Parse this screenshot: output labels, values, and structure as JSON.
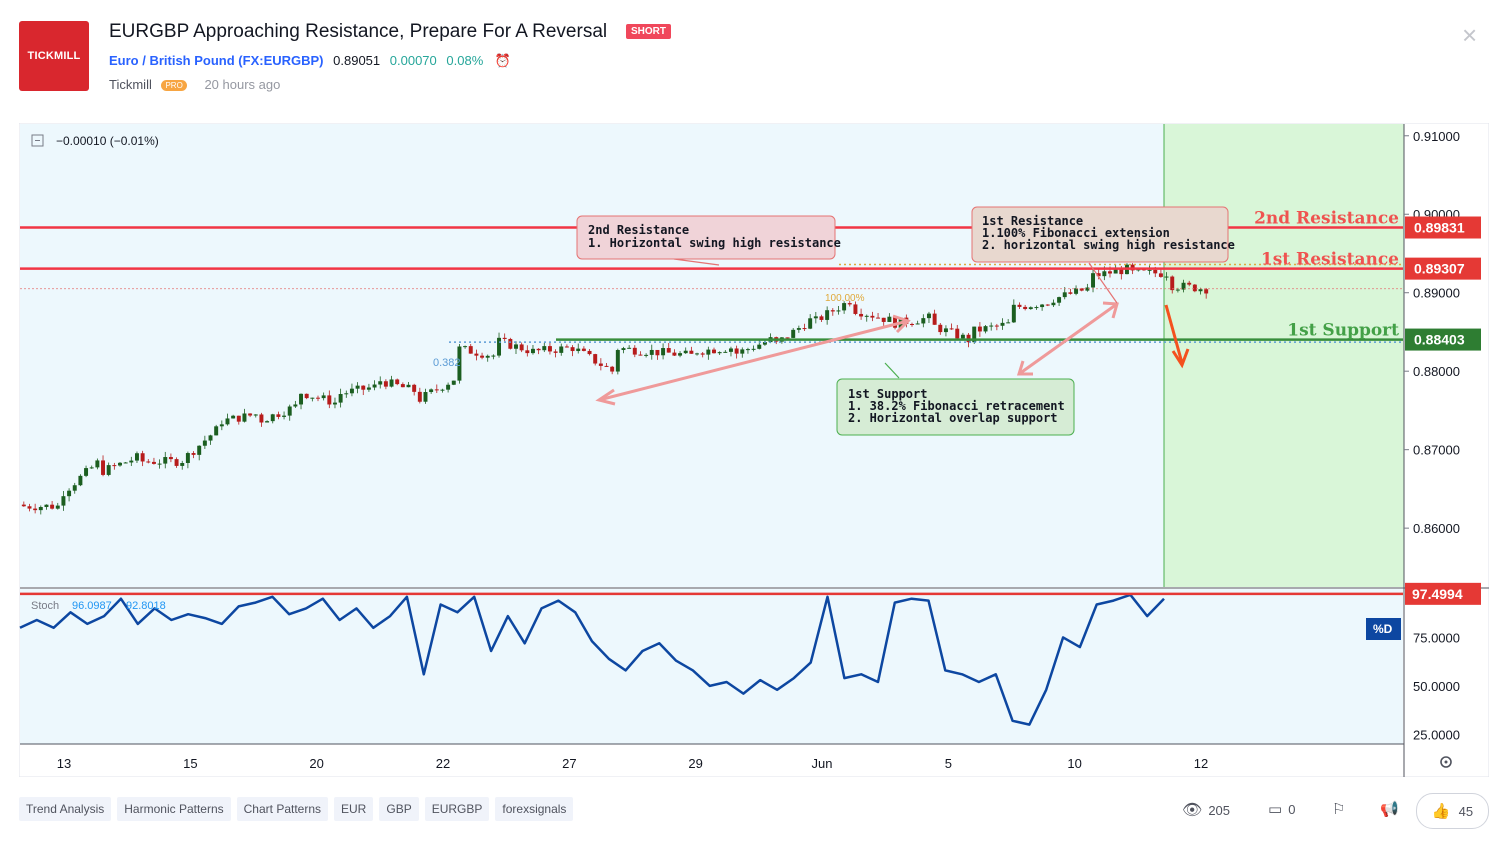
{
  "header": {
    "logo_text": "TICKMILL",
    "title": "EURGBP Approaching Resistance, Prepare For A Reversal",
    "badge": "SHORT",
    "symbol_name": "Euro / British Pound",
    "symbol_ticker": "(FX:EURGBP)",
    "price": "0.89051",
    "change": "0.00070",
    "change_pct": "0.08%",
    "author": "Tickmill",
    "author_badge": "PRO",
    "published": "20 hours ago"
  },
  "chart_data": {
    "type": "candlestick",
    "symbol": "FX:EURGBP",
    "legend_value": "−0.00010 (−0.01%)",
    "x_ticks": [
      "13",
      "15",
      "20",
      "22",
      "27",
      "29",
      "Jun",
      "5",
      "10",
      "12"
    ],
    "y_ticks": [
      "0.91000",
      "0.90000",
      "0.89000",
      "0.88000",
      "0.87000",
      "0.86000"
    ],
    "ylim": [
      0.8525,
      0.9115
    ],
    "ohlc_path": [
      [
        0.863,
        0.8628
      ],
      [
        0.8628,
        0.864
      ],
      [
        0.8683,
        0.867
      ],
      [
        0.869,
        0.8685
      ],
      [
        0.8685,
        0.868
      ],
      [
        0.8725,
        0.8735
      ],
      [
        0.8745,
        0.8735
      ],
      [
        0.8755,
        0.8775
      ],
      [
        0.876,
        0.877
      ],
      [
        0.878,
        0.879
      ],
      [
        0.8775,
        0.876
      ],
      [
        0.879,
        0.883
      ],
      [
        0.882,
        0.884
      ],
      [
        0.8825,
        0.8825
      ],
      [
        0.883,
        0.883
      ],
      [
        0.88,
        0.883
      ],
      [
        0.8825,
        0.8825
      ],
      [
        0.882,
        0.8825
      ],
      [
        0.883,
        0.882
      ],
      [
        0.884,
        0.883
      ],
      [
        0.8865,
        0.886
      ],
      [
        0.889,
        0.888
      ],
      [
        0.8865,
        0.886
      ],
      [
        0.8868,
        0.886
      ],
      [
        0.884,
        0.885
      ],
      [
        0.886,
        0.888
      ],
      [
        0.8888,
        0.889
      ],
      [
        0.8905,
        0.892
      ],
      [
        0.893,
        0.8925
      ],
      [
        0.8925,
        0.891
      ],
      [
        0.8905,
        0.8912
      ]
    ],
    "levels": [
      {
        "name": "2nd Resistance",
        "value": 0.89831,
        "label": "0.89831",
        "color": "#f23645"
      },
      {
        "name": "1st Resistance",
        "value": 0.89307,
        "label": "0.89307",
        "color": "#f23645"
      },
      {
        "name": "1st Support",
        "value": 0.88403,
        "label": "0.88403",
        "color": "#388e3c"
      }
    ],
    "fib_labels": {
      "retracement": "0.382",
      "extension": "100.00%"
    },
    "callouts": [
      {
        "title": "2nd Resistance",
        "lines": [
          "1. Horizontal swing high resistance"
        ]
      },
      {
        "title": "1st Resistance",
        "lines": [
          "1.100% Fibonacci extension",
          "2. horizontal swing high resistance"
        ]
      },
      {
        "title": "1st Support",
        "lines": [
          "1. 38.2% Fibonacci retracement",
          "2. Horizontal overlap support"
        ]
      }
    ],
    "stoch": {
      "label": "Stoch",
      "k": "96.0987",
      "d": "92.8018",
      "ylim": [
        20,
        100
      ],
      "y_ticks": [
        "75.0000",
        "50.0000",
        "25.0000"
      ],
      "level": {
        "value": 97.4994,
        "label": "97.4994"
      },
      "d_badge": "%D",
      "values": [
        80,
        84,
        80,
        88,
        82,
        86,
        95,
        82,
        90,
        84,
        87,
        85,
        82,
        91,
        93,
        96,
        87,
        90,
        95,
        84,
        90,
        80,
        86,
        96,
        56,
        92,
        88,
        96,
        68,
        86,
        72,
        90,
        94,
        88,
        73,
        64,
        58,
        68,
        72,
        63,
        58,
        50,
        52,
        46,
        53,
        48,
        54,
        62,
        96,
        54,
        56,
        52,
        93,
        95,
        94,
        58,
        56,
        52,
        56,
        32,
        30,
        48,
        75,
        70,
        92,
        94,
        97,
        86,
        95
      ]
    },
    "price_marker": "0.89051"
  },
  "tags": [
    "Trend Analysis",
    "Harmonic Patterns",
    "Chart Patterns",
    "EUR",
    "GBP",
    "EURGBP",
    "forexsignals"
  ],
  "stats": {
    "views": "205",
    "comments": "0",
    "likes": "45"
  }
}
